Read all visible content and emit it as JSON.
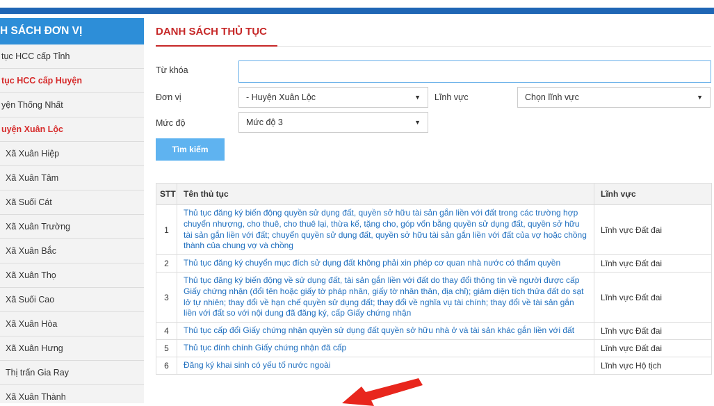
{
  "sidebar": {
    "header": "H SÁCH ĐƠN VỊ",
    "items": [
      {
        "label": "tục HCC cấp Tỉnh",
        "style": "normal"
      },
      {
        "label": "tục HCC cấp Huyện",
        "style": "red"
      },
      {
        "label": "yện Thống Nhất",
        "style": "normal"
      },
      {
        "label": "uyện Xuân Lộc",
        "style": "red"
      },
      {
        "label": "Xã Xuân Hiệp",
        "style": "indent"
      },
      {
        "label": "Xã Xuân Tâm",
        "style": "indent"
      },
      {
        "label": "Xã Suối Cát",
        "style": "indent"
      },
      {
        "label": "Xã Xuân Trường",
        "style": "indent"
      },
      {
        "label": "Xã Xuân Bắc",
        "style": "indent"
      },
      {
        "label": "Xã Xuân Thọ",
        "style": "indent"
      },
      {
        "label": "Xã Suối Cao",
        "style": "indent"
      },
      {
        "label": "Xã Xuân Hòa",
        "style": "indent"
      },
      {
        "label": "Xã Xuân Hưng",
        "style": "indent"
      },
      {
        "label": "Thị trấn Gia Ray",
        "style": "indent"
      },
      {
        "label": "Xã Xuân Thành",
        "style": "indent"
      }
    ]
  },
  "main": {
    "title": "DANH SÁCH THỦ TỤC",
    "form": {
      "keyword_label": "Từ khóa",
      "keyword_value": "",
      "unit_label": "Đơn vị",
      "unit_value": "- Huyện Xuân Lộc",
      "field_label": "Lĩnh vực",
      "field_value": "Chọn lĩnh vực",
      "level_label": "Mức độ",
      "level_value": "Mức độ 3",
      "search_button": "Tìm kiếm"
    },
    "table": {
      "headers": {
        "stt": "STT",
        "name": "Tên thủ tục",
        "field": "Lĩnh vực"
      },
      "rows": [
        {
          "stt": "1",
          "name": "Thủ tục đăng ký biến động quyền sử dụng đất, quyền sở hữu tài sản gắn liền với đất trong các trường hợp chuyển nhượng, cho thuê, cho thuê lại, thừa kế, tặng cho, góp vốn bằng quyền sử dụng đất, quyền sở hữu tài sản gắn liền với đất; chuyển quyền sử dụng đất, quyền sở hữu tài sản gắn liền với đất của vợ hoặc chồng thành của chung vợ và chồng",
          "field": "Lĩnh vực Đất đai"
        },
        {
          "stt": "2",
          "name": "Thủ tục đăng ký chuyển mục đích sử dụng đất không phải xin phép cơ quan nhà nước có thẩm quyền",
          "field": "Lĩnh vực Đất đai"
        },
        {
          "stt": "3",
          "name": "Thủ tục đăng ký biến động về sử dụng đất, tài sản gắn liền với đất do thay đổi thông tin về người được cấp Giấy chứng nhận (đổi tên hoặc giấy tờ pháp nhân, giấy tờ nhân thân, địa chỉ); giảm diện tích thửa đất do sạt lở tự nhiên; thay đổi về hạn chế quyền sử dụng đất; thay đổi về nghĩa vụ tài chính; thay đổi về tài sản gắn liền với đất so với nội dung đã đăng ký, cấp Giấy chứng nhận",
          "field": "Lĩnh vực Đất đai"
        },
        {
          "stt": "4",
          "name": "Thủ tục cấp đổi Giấy chứng nhận quyền sử dụng đất quyền sở hữu nhà ở và tài sản khác gắn liền với đất",
          "field": "Lĩnh vực Đất đai"
        },
        {
          "stt": "5",
          "name": "Thủ tục đính chính Giấy chứng nhận đã cấp",
          "field": "Lĩnh vực Đất đai"
        },
        {
          "stt": "6",
          "name": "Đăng ký khai sinh có yếu tố nước ngoài",
          "field": "Lĩnh vực Hộ tịch"
        }
      ]
    }
  },
  "colors": {
    "topbar": "#1f66b5",
    "sidebar_header": "#2d8ed8",
    "title": "#c62828",
    "link": "#1f6fbf",
    "button": "#5fb3f0",
    "arrow": "#e8261d"
  }
}
